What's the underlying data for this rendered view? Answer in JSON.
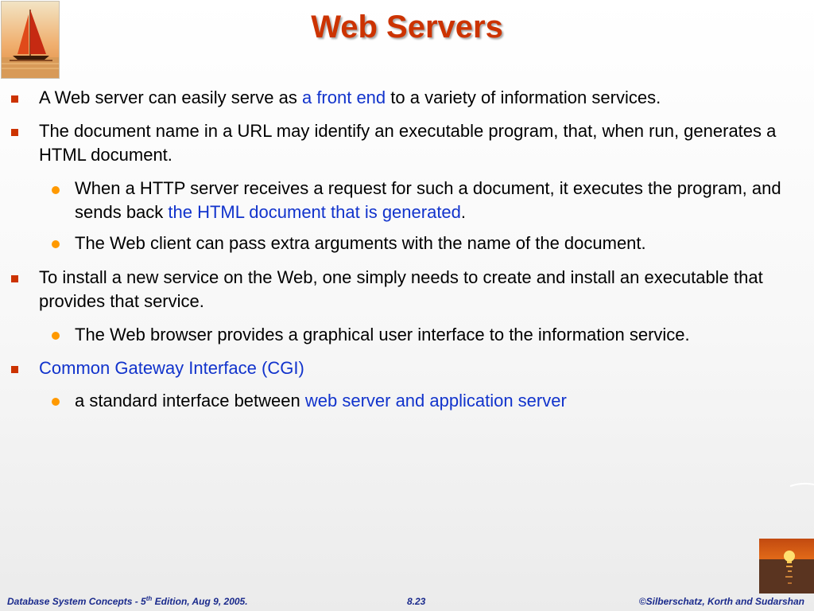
{
  "title": "Web Servers",
  "bullets": [
    {
      "level": 1,
      "parts": [
        {
          "text": "A Web server can easily serve as ",
          "color": "black"
        },
        {
          "text": "a front end",
          "color": "blue"
        },
        {
          "text": " to a variety of information services.",
          "color": "black"
        }
      ]
    },
    {
      "level": 1,
      "parts": [
        {
          "text": "The document name in a URL may identify an executable program, that, when run, generates a HTML document.",
          "color": "black"
        }
      ]
    },
    {
      "level": 2,
      "parts": [
        {
          "text": "When a HTTP server receives a request for such a document, it executes the program, and sends back ",
          "color": "black"
        },
        {
          "text": "the HTML document that is generated",
          "color": "blue"
        },
        {
          "text": ".",
          "color": "black"
        }
      ]
    },
    {
      "level": 2,
      "parts": [
        {
          "text": "The Web client can pass extra arguments with the name of the document.",
          "color": "black"
        }
      ]
    },
    {
      "level": 1,
      "parts": [
        {
          "text": "To install a new service on the Web, one simply needs to create and install an executable that provides that service.",
          "color": "black"
        }
      ]
    },
    {
      "level": 2,
      "parts": [
        {
          "text": "The Web browser provides a graphical user interface to the information service.",
          "color": "black"
        }
      ]
    },
    {
      "level": 1,
      "parts": [
        {
          "text": "Common Gateway Interface (CGI)",
          "color": "blue"
        }
      ]
    },
    {
      "level": 2,
      "parts": [
        {
          "text": "a standard interface between ",
          "color": "black"
        },
        {
          "text": "web server and application server",
          "color": "blue"
        }
      ]
    }
  ],
  "footer": {
    "left_prefix": "Database System Concepts - 5",
    "left_sup": "th",
    "left_suffix": " Edition,  Aug 9, 2005.",
    "page": "8.23",
    "right": "©Silberschatz, Korth and Sudarshan"
  },
  "colors": {
    "title": "#cc3300",
    "square_bullet": "#cc3300",
    "dot_bullet": "#ff9900",
    "link_blue": "#1133cc",
    "footer_text": "#1a2a8c"
  },
  "icons": {
    "logo": "sailboat-image",
    "footer_image": "sunset-image"
  }
}
